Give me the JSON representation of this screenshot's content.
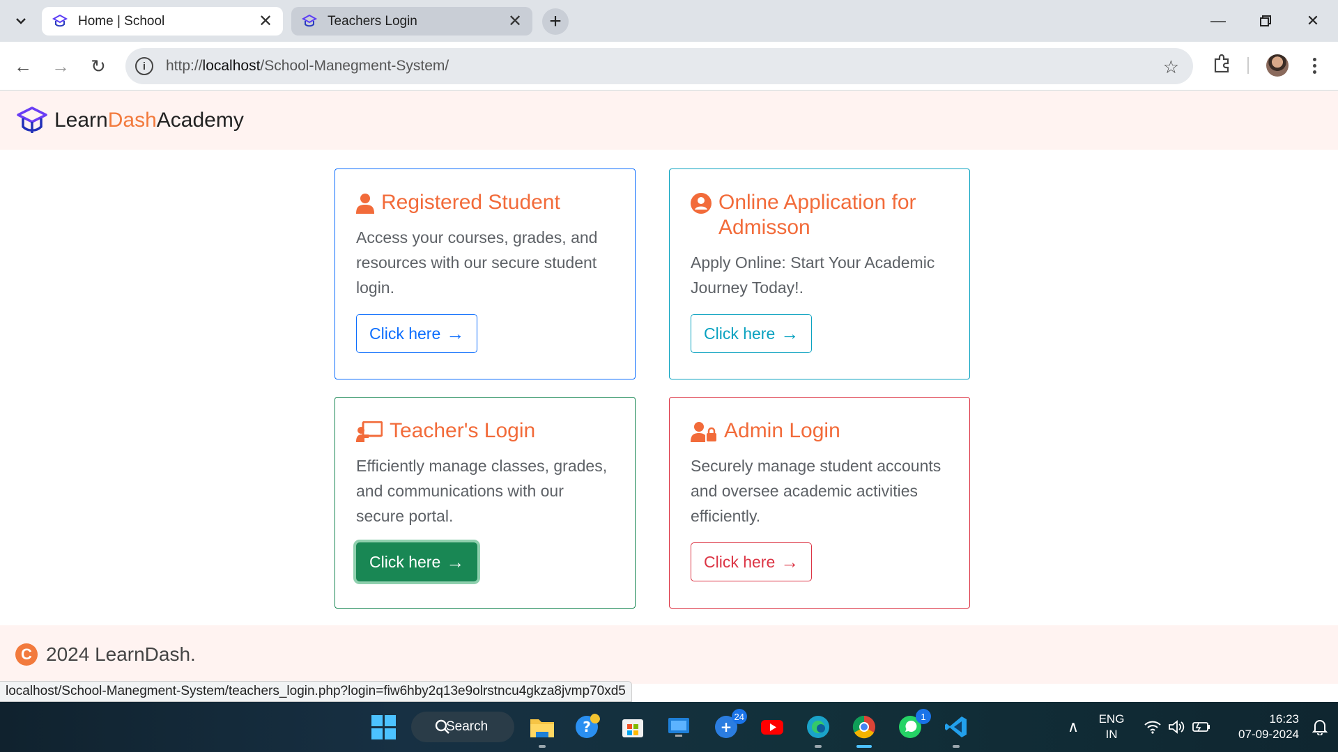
{
  "browser": {
    "tabs": [
      {
        "title": "Home | School",
        "active": true
      },
      {
        "title": "Teachers Login",
        "active": false
      }
    ],
    "url_prefix": "http://",
    "url_host": "localhost",
    "url_path": "/School-Manegment-System/",
    "status_url": "localhost/School-Manegment-System/teachers_login.php?login=fiw6hby2q13e9olrstncu4gkza8jvmp70xd5"
  },
  "site": {
    "brand_part1": "Learn",
    "brand_part2": "Dash",
    "brand_part3": "Academy",
    "footer_text": "2024 LearnDash.",
    "footer_icon": "C"
  },
  "cards": [
    {
      "id": "student",
      "icon": "user-icon",
      "title": "Registered Student",
      "text": "Access your courses, grades, and resources with our secure student login.",
      "button": "Click here",
      "variant": "blue"
    },
    {
      "id": "admission",
      "icon": "user-circle-icon",
      "title": "Online Application for Admisson",
      "text": "Apply Online: Start Your Academic Journey Today!.",
      "button": "Click here",
      "variant": "cyan"
    },
    {
      "id": "teacher",
      "icon": "chalkboard-teacher-icon",
      "title": "Teacher's Login",
      "text": "Efficiently manage classes, grades, and communications with our secure portal.",
      "button": "Click here",
      "variant": "green"
    },
    {
      "id": "admin",
      "icon": "user-lock-icon",
      "title": "Admin Login",
      "text": "Securely manage student accounts and oversee academic activities efficiently.",
      "button": "Click here",
      "variant": "red"
    }
  ],
  "taskbar": {
    "search_label": "Search",
    "teams_badge": "24",
    "whatsapp_badge": "1",
    "lang_top": "ENG",
    "lang_bottom": "IN",
    "time": "16:23",
    "date": "07-09-2024"
  },
  "colors": {
    "accent": "#f27a3d",
    "title": "#f26b3a",
    "blue": "#0d6efd",
    "cyan": "#0aa2c0",
    "green": "#198754",
    "red": "#dc3545",
    "navbar_bg": "#fff3f1"
  }
}
